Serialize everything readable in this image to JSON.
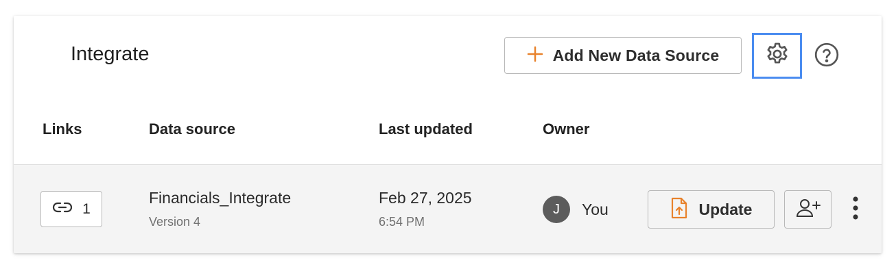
{
  "header": {
    "title": "Integrate",
    "add_button_label": "Add New Data Source",
    "icons": {
      "add": "plus-icon",
      "settings": "gear-icon",
      "help": "help-circle-icon"
    },
    "accent_color": "#e8822c",
    "focus_color": "#4a8cf0"
  },
  "table": {
    "columns": [
      "Links",
      "Data source",
      "Last updated",
      "Owner"
    ],
    "rows": [
      {
        "links_count": "1",
        "name": "Financials_Integrate",
        "version": "Version 4",
        "date": "Feb 27, 2025",
        "time": "6:54 PM",
        "owner_initial": "J",
        "owner_name": "You",
        "update_label": "Update",
        "icons": {
          "links": "link-icon",
          "update": "file-upload-icon",
          "share": "add-user-icon",
          "more": "kebab-menu-icon"
        }
      }
    ]
  }
}
